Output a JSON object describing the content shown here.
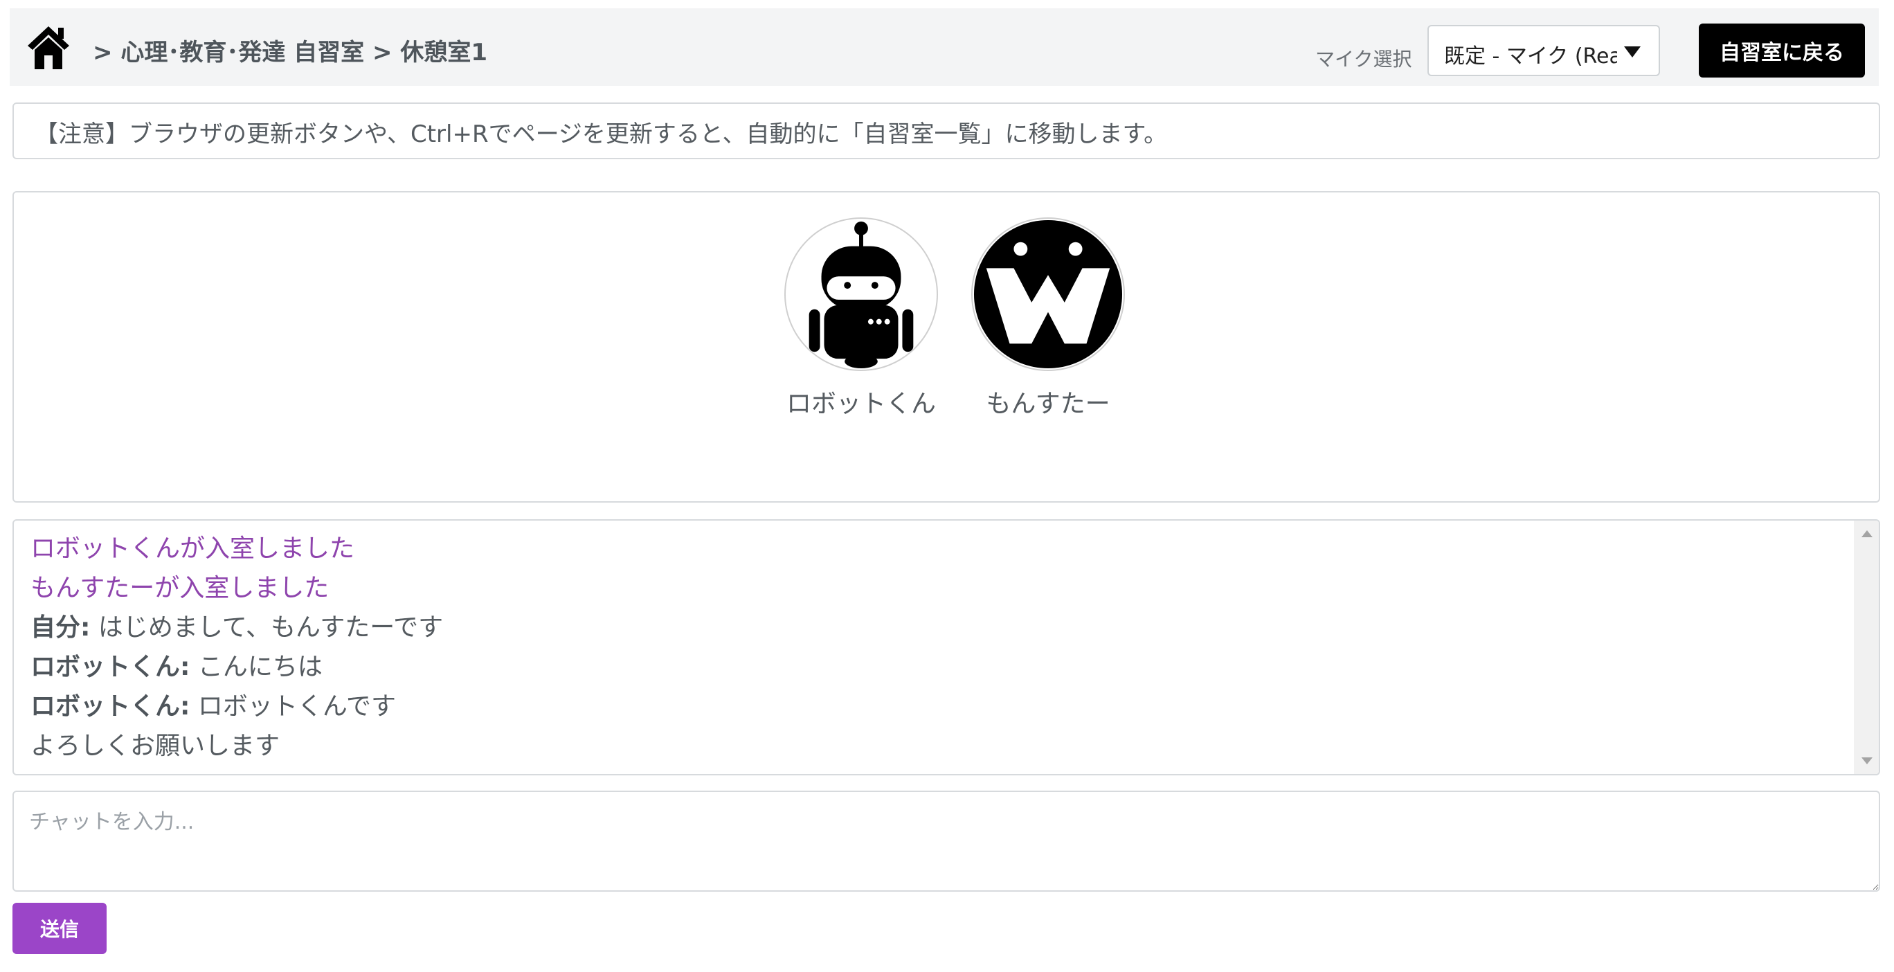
{
  "header": {
    "home_icon": "house-icon",
    "breadcrumb": "> 心理･教育･発達 自習室 > 休憩室1",
    "mic_label": "マイク選択",
    "mic_selected": "既定 - マイク (Realtek Audio)",
    "back_button": "自習室に戻る"
  },
  "notice": "【注意】ブラウザの更新ボタンや、Ctrl+Rでページを更新すると、自動的に「自習室一覧」に移動します。",
  "participants": [
    {
      "name": "ロボットくん",
      "icon": "robot-avatar-icon"
    },
    {
      "name": "もんすたー",
      "icon": "monster-avatar-icon"
    }
  ],
  "chat_log": {
    "system": [
      "ロボットくんが入室しました",
      "もんすたーが入室しました"
    ],
    "messages": [
      {
        "speaker": "自分:",
        "text": " はじめまして、もんすたーです"
      },
      {
        "speaker": "ロボットくん:",
        "text": " こんにちは"
      },
      {
        "speaker": "ロボットくん:",
        "text": " ロボットくんです"
      }
    ],
    "continuation": "よろしくお願いします"
  },
  "chat_input": {
    "placeholder": "チャットを入力..."
  },
  "send_button": "送信",
  "colors": {
    "accent": "#9b45c8",
    "system_text": "#8e44ad",
    "back_button_bg": "#000000",
    "header_bg": "#f3f4f5"
  }
}
